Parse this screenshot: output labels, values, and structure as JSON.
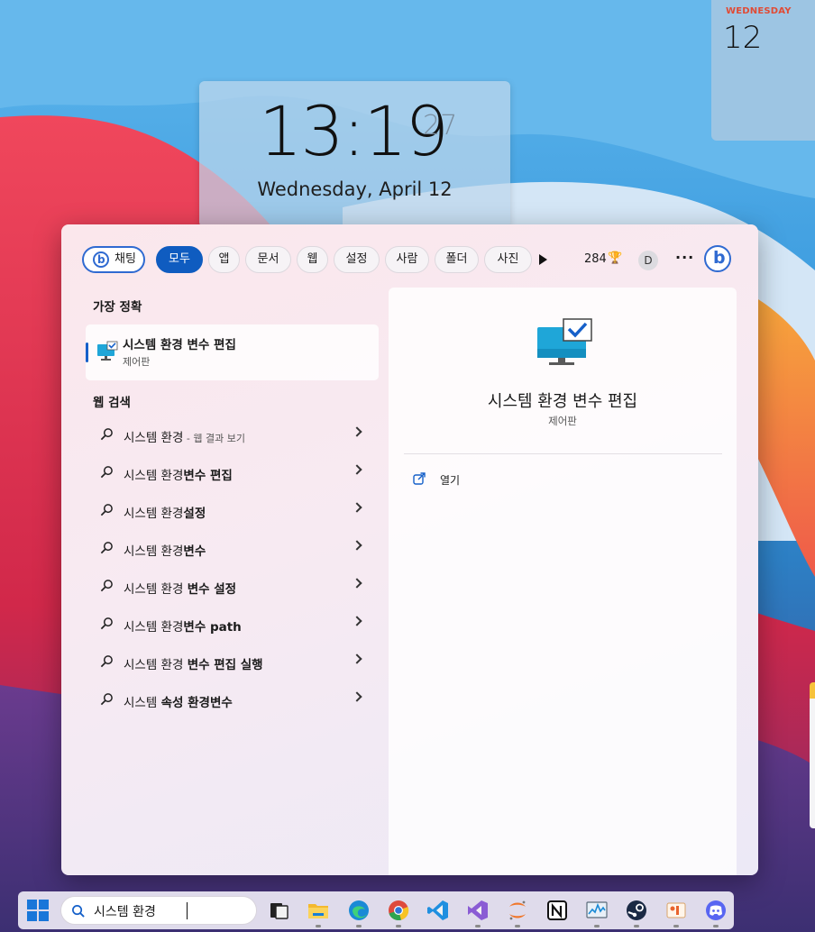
{
  "widgets": {
    "clock": {
      "time": "13:19",
      "seconds": "27",
      "date": "Wednesday, April 12"
    },
    "calendar": {
      "weekday": "WEDNESDAY",
      "day": "12"
    }
  },
  "search_panel": {
    "filters": [
      {
        "id": "chat",
        "label": "채팅"
      },
      {
        "id": "all",
        "label": "모두",
        "active": true
      },
      {
        "id": "apps",
        "label": "앱"
      },
      {
        "id": "documents",
        "label": "문서"
      },
      {
        "id": "web",
        "label": "웹"
      },
      {
        "id": "settings",
        "label": "설정"
      },
      {
        "id": "people",
        "label": "사람"
      },
      {
        "id": "folders",
        "label": "폴더"
      },
      {
        "id": "photos",
        "label": "사진"
      }
    ],
    "points": "284",
    "account_initial": "D",
    "more_label": "···",
    "best_match": {
      "heading": "가장 정확",
      "name": "시스템 환경 변수 편집",
      "subtitle": "제어판"
    },
    "web_search": {
      "heading": "웹 검색",
      "results": [
        {
          "prefix": "시스템 환경",
          "bold": "",
          "suffix": " - 웹 결과 보기"
        },
        {
          "prefix": "시스템 환경",
          "bold": "변수 편집",
          "suffix": ""
        },
        {
          "prefix": "시스템 환경",
          "bold": "설정",
          "suffix": ""
        },
        {
          "prefix": "시스템 환경",
          "bold": "변수",
          "suffix": ""
        },
        {
          "prefix": "시스템 환경 ",
          "bold": "변수 설정",
          "suffix": ""
        },
        {
          "prefix": "시스템 환경",
          "bold": "변수 path",
          "suffix": ""
        },
        {
          "prefix": "시스템 환경 ",
          "bold": "변수 편집 실행",
          "suffix": ""
        },
        {
          "prefix": "시스템 ",
          "bold": "속성 환경변수",
          "suffix": ""
        }
      ]
    },
    "detail": {
      "name": "시스템 환경 변수 편집",
      "subtitle": "제어판",
      "open_label": "열기"
    }
  },
  "taskbar": {
    "search_value": "시스템 환경",
    "apps": [
      "task-view",
      "file-explorer",
      "edge",
      "chrome",
      "vscode",
      "visual-studio",
      "jupyter",
      "notion",
      "resource-monitor",
      "steam",
      "paint",
      "discord"
    ]
  },
  "colors": {
    "accent": "#0f5cc0",
    "bing": "#2f6ad1",
    "calendar_weekday": "#e04b35"
  }
}
